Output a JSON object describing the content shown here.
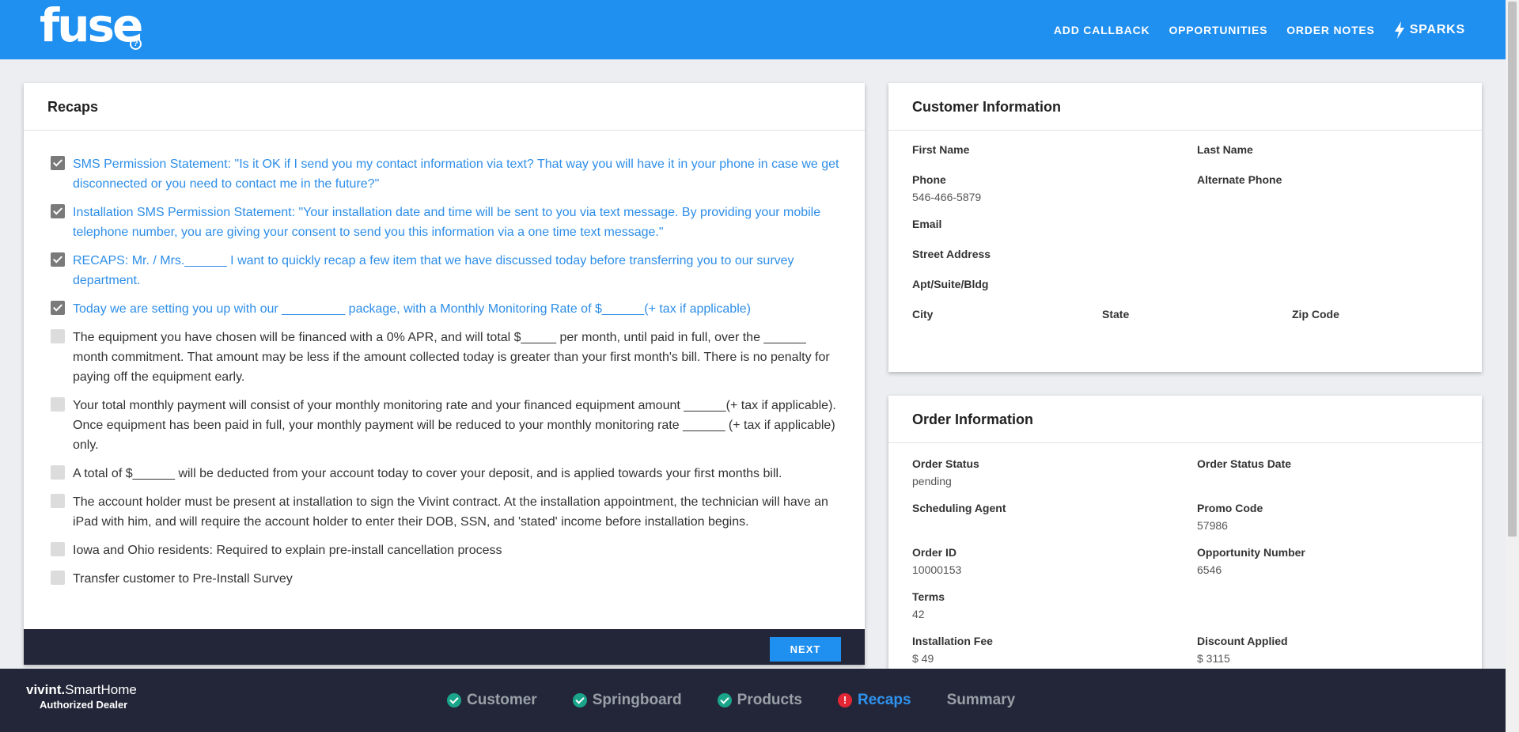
{
  "header": {
    "logo_text": "fuse",
    "logo_help": "?",
    "nav": [
      "ADD CALLBACK",
      "OPPORTUNITIES",
      "ORDER NOTES"
    ],
    "sparks": "SPARKS"
  },
  "recaps": {
    "title": "Recaps",
    "items": [
      {
        "text": "SMS Permission Statement: \"Is it OK if I send you my contact information via text? That way you will have it in your phone in case we get disconnected or you need to contact me in the future?\"",
        "checked": true
      },
      {
        "text": "Installation SMS Permission Statement: \"Your installation date and time will be sent to you via text message. By providing your mobile telephone number, you are giving your consent to send you this information via a one time text message.\"",
        "checked": true
      },
      {
        "text": "RECAPS: Mr. / Mrs.______ I want to quickly recap a few item that we have discussed today before transferring you to our survey department.",
        "checked": true
      },
      {
        "text": "Today we are setting you up with our _________ package, with a Monthly Monitoring Rate of $______(+ tax if applicable)",
        "checked": true
      },
      {
        "text": "The equipment you have chosen will be financed with a 0% APR, and will total $_____ per month, until paid in full, over the ______ month commitment. That amount may be less if the amount collected today is greater than your first month's bill. There is no penalty for paying off the equipment early.",
        "checked": false
      },
      {
        "text": "Your total monthly payment will consist of your monthly monitoring rate and your financed equipment amount ______(+ tax if applicable). Once equipment has been paid in full, your monthly payment will be reduced to your monthly monitoring rate ______ (+ tax if applicable) only.",
        "checked": false
      },
      {
        "text": "A total of $______ will be deducted from your account today to cover your deposit, and is applied towards your first months bill.",
        "checked": false
      },
      {
        "text": "The account holder must be present at installation to sign the Vivint contract. At the installation appointment, the technician will have an iPad with him, and will require the account holder to enter their DOB, SSN, and 'stated' income before installation begins.",
        "checked": false
      },
      {
        "text": "Iowa and Ohio residents: Required to explain pre-install cancellation process",
        "checked": false
      },
      {
        "text": "Transfer customer to Pre-Install Survey",
        "checked": false
      }
    ],
    "next_label": "NEXT"
  },
  "customer": {
    "title": "Customer Information",
    "first_name_label": "First Name",
    "last_name_label": "Last Name",
    "phone_label": "Phone",
    "phone_value": "546-466-5879",
    "alt_phone_label": "Alternate Phone",
    "email_label": "Email",
    "street_label": "Street Address",
    "apt_label": "Apt/Suite/Bldg",
    "city_label": "City",
    "state_label": "State",
    "zip_label": "Zip Code"
  },
  "order": {
    "title": "Order Information",
    "status_label": "Order Status",
    "status_value": "pending",
    "status_date_label": "Order Status Date",
    "agent_label": "Scheduling Agent",
    "promo_label": "Promo Code",
    "promo_value": "57986",
    "order_id_label": "Order ID",
    "order_id_value": "10000153",
    "opp_label": "Opportunity Number",
    "opp_value": "6546",
    "terms_label": "Terms",
    "terms_value": "42",
    "install_fee_label": "Installation Fee",
    "install_fee_value": "$ 49",
    "discount_label": "Discount Applied",
    "discount_value": "$ 3115"
  },
  "footer": {
    "brand_bold": "vivint.",
    "brand_rest": "SmartHome",
    "dealer": "Authorized Dealer",
    "steps": [
      {
        "label": "Customer",
        "status": "done"
      },
      {
        "label": "Springboard",
        "status": "done"
      },
      {
        "label": "Products",
        "status": "done"
      },
      {
        "label": "Recaps",
        "status": "error"
      },
      {
        "label": "Summary",
        "status": "none"
      }
    ]
  }
}
